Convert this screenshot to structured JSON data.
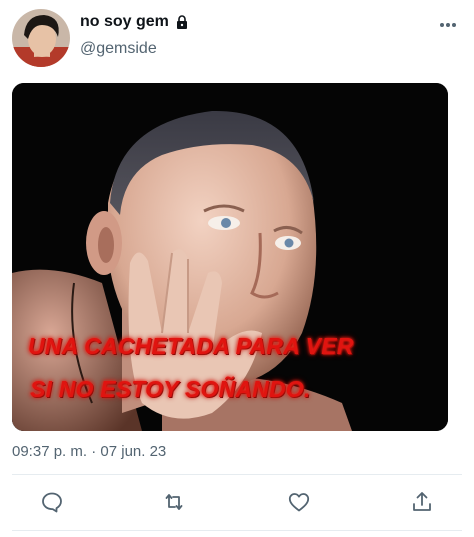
{
  "author": {
    "display_name": "no soy gem",
    "handle": "@gemside",
    "protected_icon": "lock-icon",
    "avatar": "profile-avatar"
  },
  "media": {
    "caption_line1": "UNA CACHETADA PARA VER",
    "caption_line2": "SI NO ESTOY SOÑANDO."
  },
  "meta": {
    "time": "09:37 p. m.",
    "separator": "·",
    "date": "07 jun. 23"
  },
  "actions": [
    {
      "icon": "reply-icon"
    },
    {
      "icon": "retweet-icon"
    },
    {
      "icon": "like-icon"
    },
    {
      "icon": "share-icon"
    }
  ],
  "colors": {
    "secondary_text": "#536471",
    "caption_red": "#e01410",
    "divider": "#e6ecf0"
  }
}
